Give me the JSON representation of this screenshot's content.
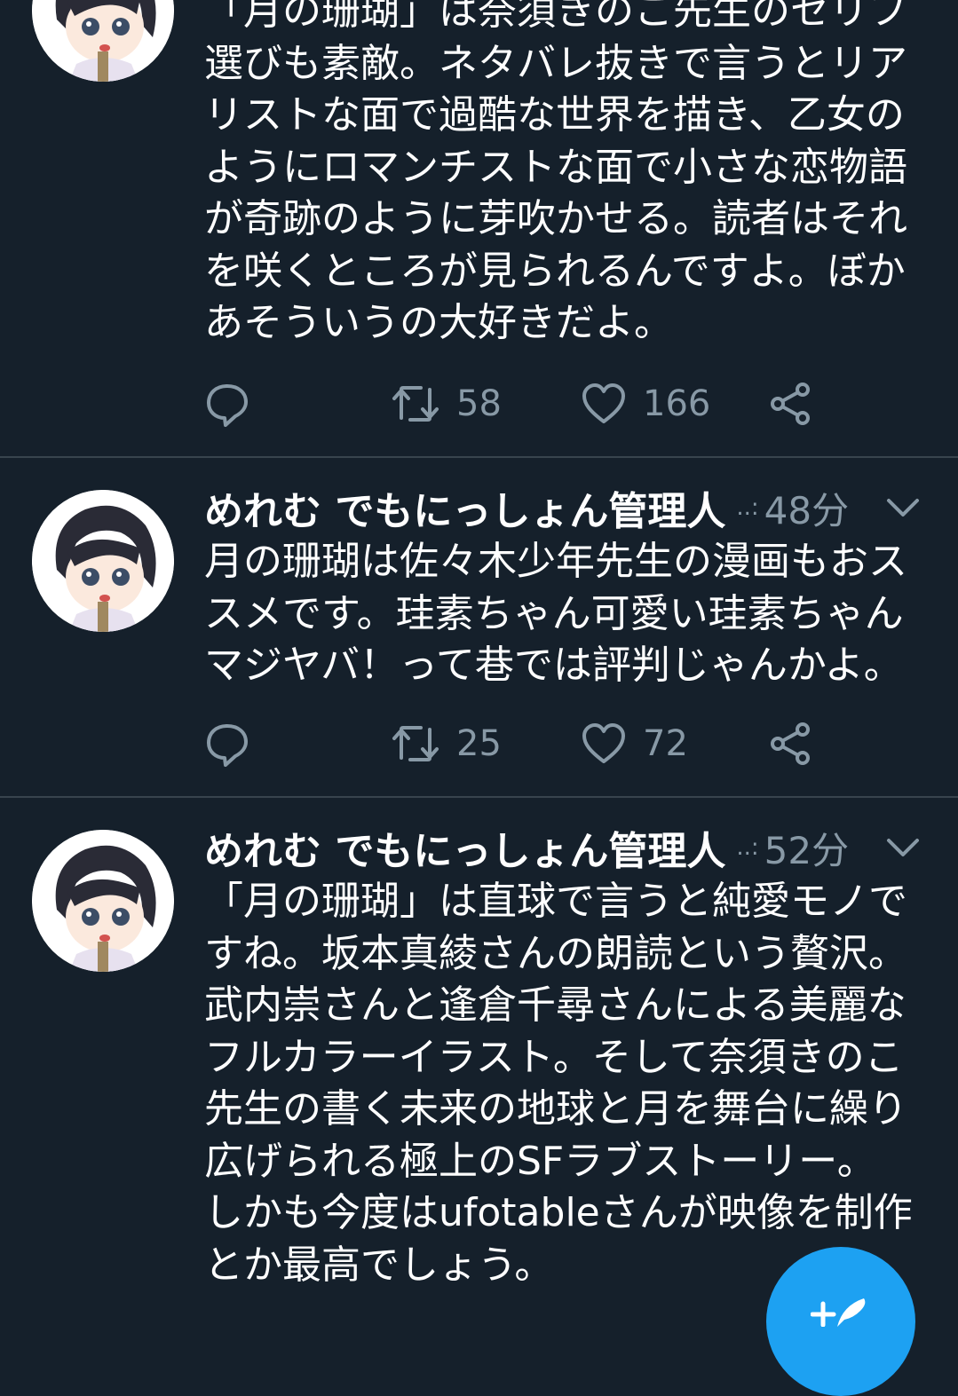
{
  "colors": {
    "background": "#15202b",
    "text": "#ffffff",
    "secondary": "#8899a6",
    "divider": "#38444d",
    "accent": "#1da1f2"
  },
  "tweets": [
    {
      "lines": [
        "「月の珊瑚」は奈須きのこ先生のセリフ",
        "選びも素敵。ネタバレ抜きで言うとリア",
        "リストな面で過酷な世界を描き、乙女の",
        "ようにロマンチストな面で小さな恋物語",
        "が奇跡のように芽吹かせる。読者はそれ",
        "を咲くところが見られるんですよ。ぼか",
        "あそういうの大好きだよ。"
      ],
      "retweets": "58",
      "likes": "166"
    },
    {
      "name": "めれむ でもにっしょん管理人",
      "handle": "..:",
      "time": "48分",
      "lines": [
        "月の珊瑚は佐々木少年先生の漫画もおス",
        "スメです。珪素ちゃん可愛い珪素ちゃん",
        "マジヤバ！って巷では評判じゃんかよ。"
      ],
      "retweets": "25",
      "likes": "72"
    },
    {
      "name": "めれむ でもにっしょん管理人",
      "handle": "..:",
      "time": "52分",
      "lines": [
        "「月の珊瑚」は直球で言うと純愛モノで",
        "すね。坂本真綾さんの朗読という贅沢。",
        "武内崇さんと逢倉千尋さんによる美麗な",
        "フルカラーイラスト。そして奈須きのこ",
        "先生の書く未来の地球と月を舞台に繰り",
        "広げられる極上のSFラブストーリー。",
        "しかも今度はufotableさんが映像を制作",
        "とか最高でしょう。"
      ]
    }
  ],
  "icons": {
    "reply": "reply-icon",
    "retweet": "retweet-icon",
    "like": "heart-icon",
    "share": "share-icon",
    "caret": "chevron-down-icon",
    "compose": "compose-tweet-icon"
  }
}
